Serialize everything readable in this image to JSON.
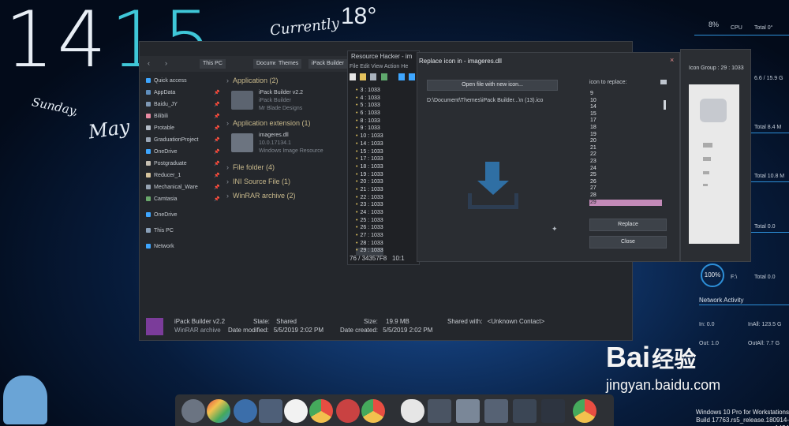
{
  "clock": {
    "hours": "14",
    "minutes": "15",
    "weekday": "Sunday,",
    "month": "May"
  },
  "weather": {
    "label": "Currently",
    "temperature": "18°"
  },
  "explorer": {
    "breadcrumb": [
      "This PC",
      "Documents",
      "Themes",
      "iPack Builder"
    ],
    "nav": [
      {
        "label": "Quick access",
        "icon": "star-icon",
        "color": "#3ea6ff",
        "pinned": false
      },
      {
        "label": "AppData",
        "icon": "folder-icon",
        "color": "#5f8ebd",
        "pinned": true
      },
      {
        "label": "Baidu_JY",
        "icon": "folder-icon",
        "color": "#7f98b4",
        "pinned": true
      },
      {
        "label": "Bilibili",
        "icon": "folder-icon",
        "color": "#e88aa2",
        "pinned": true
      },
      {
        "label": "Protable",
        "icon": "folder-icon",
        "color": "#b3bbc6",
        "pinned": true
      },
      {
        "label": "GraduationProject",
        "icon": "folder-icon",
        "color": "#9aa6b5",
        "pinned": true
      },
      {
        "label": "OneDrive",
        "icon": "cloud-icon",
        "color": "#3ea6ff",
        "pinned": true
      },
      {
        "label": "Postgraduate",
        "icon": "folder-icon",
        "color": "#c7c0b3",
        "pinned": true
      },
      {
        "label": "Reducer_1",
        "icon": "folder-icon",
        "color": "#d7c49d",
        "pinned": true
      },
      {
        "label": "Mechanical_Ware",
        "icon": "folder-icon",
        "color": "#97a4b3",
        "pinned": true
      },
      {
        "label": "Camtasia",
        "icon": "folder-icon",
        "color": "#6aa86b",
        "pinned": true
      },
      {
        "label": "OneDrive",
        "icon": "cloud-icon",
        "color": "#3ea6ff",
        "pinned": false
      },
      {
        "label": "This PC",
        "icon": "pc-icon",
        "color": "#8aa0b8",
        "pinned": false
      },
      {
        "label": "Network",
        "icon": "network-icon",
        "color": "#3ea6ff",
        "pinned": false
      }
    ],
    "groups": [
      {
        "title": "Application (2)",
        "items": [
          {
            "name": "iPack Builder v2.2",
            "line2": "iPack Builder",
            "line3": "Mr Blade Designs"
          }
        ]
      },
      {
        "title": "Application extension (1)",
        "items": [
          {
            "name": "imageres.dll",
            "line2": "10.0.17134.1",
            "line3": "Windows Image Resource"
          }
        ]
      },
      {
        "title": "File folder (4)",
        "items": []
      },
      {
        "title": "INI Source File (1)",
        "items": []
      },
      {
        "title": "WinRAR archive (2)",
        "items": []
      }
    ],
    "status": {
      "name": "iPack Builder v2.2",
      "type": "WinRAR archive",
      "state_label": "State:",
      "state_value": "Shared",
      "modified_label": "Date modified:",
      "modified_value": "5/5/2019 2:02 PM",
      "size_label": "Size:",
      "size_value": "19.9 MB",
      "created_label": "Date created:",
      "created_value": "5/5/2019 2:02 PM",
      "shared_label": "Shared with:",
      "shared_value": "<Unknown Contact>"
    }
  },
  "resource_hacker": {
    "title": "Resource Hacker - im",
    "menu": [
      "File",
      "Edit",
      "View",
      "Action",
      "He"
    ],
    "rows": [
      "3 : 1033",
      "4 : 1033",
      "5 : 1033",
      "6 : 1033",
      "8 : 1033",
      "9 : 1033",
      "10 : 1033",
      "14 : 1033",
      "15 : 1033",
      "17 : 1033",
      "18 : 1033",
      "19 : 1033",
      "20 : 1033",
      "21 : 1033",
      "22 : 1033",
      "23 : 1033",
      "24 : 1033",
      "25 : 1033",
      "26 : 1033",
      "27 : 1033",
      "28 : 1033",
      "29 : 1033"
    ],
    "status_left": "76 / 34357F8",
    "status_right": "10:1"
  },
  "dialog": {
    "title": "Replace icon in - imageres.dll",
    "open_button": "Open file with new icon...",
    "file_path": "D:\\Document\\Themes\\iPack Builder...\\n (13).ico",
    "icon_label": "icon to replace:",
    "icons": [
      "9",
      "10",
      "14",
      "15",
      "17",
      "18",
      "19",
      "20",
      "21",
      "22",
      "23",
      "24",
      "25",
      "26",
      "27",
      "28",
      "29"
    ],
    "selected_icon": "29",
    "replace_button": "Replace",
    "close_button": "Close",
    "close_x": "×"
  },
  "group_pane": {
    "title": "Icon Group : 29 : 1033"
  },
  "stats": {
    "cpu_percent": "8%",
    "cpu_label": "CPU",
    "lines": [
      {
        "left": "",
        "right": "Total 0°"
      },
      {
        "left": "6.6 /",
        "right": "15.9 G"
      },
      {
        "left": "",
        "right": "Total 8.4 M"
      },
      {
        "left": "",
        "right": "Total 10.8 M"
      },
      {
        "left": "",
        "right": "Total 0.0"
      },
      {
        "left": "",
        "right": "Total 0.0"
      }
    ],
    "disk_percent": "100%",
    "disk_label": "F:\\",
    "network_title": "Network Activity",
    "in_label": "In: 0.0",
    "inall_label": "InAll: 123.5 G",
    "out_label": "Out: 1.0",
    "outall_label": "OutAll: 7.7 G"
  },
  "watermark": {
    "brand": "Bai",
    "brand2": "经验",
    "url": "jingyan.baidu.com"
  },
  "os_build": {
    "line1": "Windows 10 Pro for Workstations",
    "line2": "Build 17763.rs5_release.180914-1434"
  }
}
